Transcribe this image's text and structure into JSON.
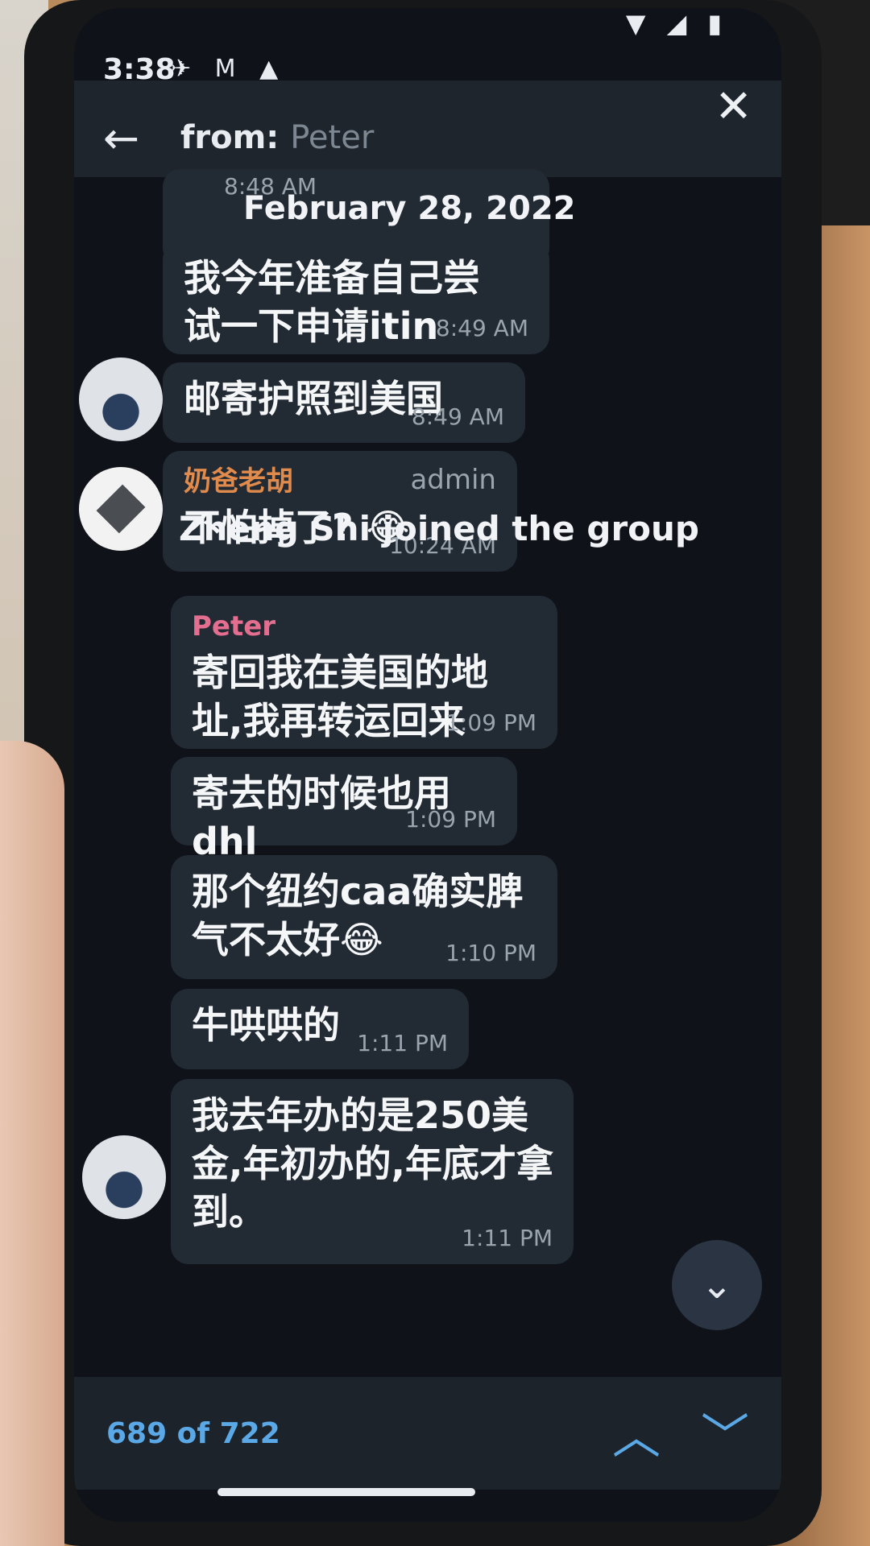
{
  "status_bar": {
    "time": "3:38",
    "left_icons": "✈ M ▲",
    "right_icons": "▼ ◢ ▮"
  },
  "header": {
    "back_icon": "←",
    "search_prefix": "from:",
    "search_name": "Peter",
    "close_icon": "✕"
  },
  "chat": {
    "date_label": "February 28, 2022",
    "partial_time": "8:48 AM",
    "messages": [
      {
        "text": "我今年准备自己尝试一下申请itin",
        "time": "8:49 AM"
      },
      {
        "text": "邮寄护照到美国",
        "time": "8:49 AM"
      },
      {
        "sender": "奶爸老胡",
        "tag": "admin",
        "text": "不怕掉了?",
        "emoji": "😂",
        "time": "10:24 AM"
      },
      {
        "sender": "Peter",
        "text": "寄回我在美国的地址,我再转运回来",
        "time": "1:09 PM"
      },
      {
        "text": "寄去的时候也用dhl",
        "time": "1:09 PM"
      },
      {
        "text": "那个纽约caa确实脾气不太好",
        "emoji": "😂",
        "time": "1:10 PM"
      },
      {
        "text": "牛哄哄的",
        "time": "1:11 PM"
      },
      {
        "text": "我去年办的是250美金,年初办的,年底才拿到。",
        "time": "1:11 PM"
      }
    ],
    "service_message": "Zheng Shi joined the group"
  },
  "scroll_down_icon": "⌄",
  "bottom_bar": {
    "counter": "689 of 722",
    "up_icon": "︿",
    "down_icon": "﹀"
  },
  "colors": {
    "accent": "#5aa8e6",
    "bubble": "#222a33",
    "admin_name": "#e08a4c",
    "peter_name": "#e46e8f"
  }
}
